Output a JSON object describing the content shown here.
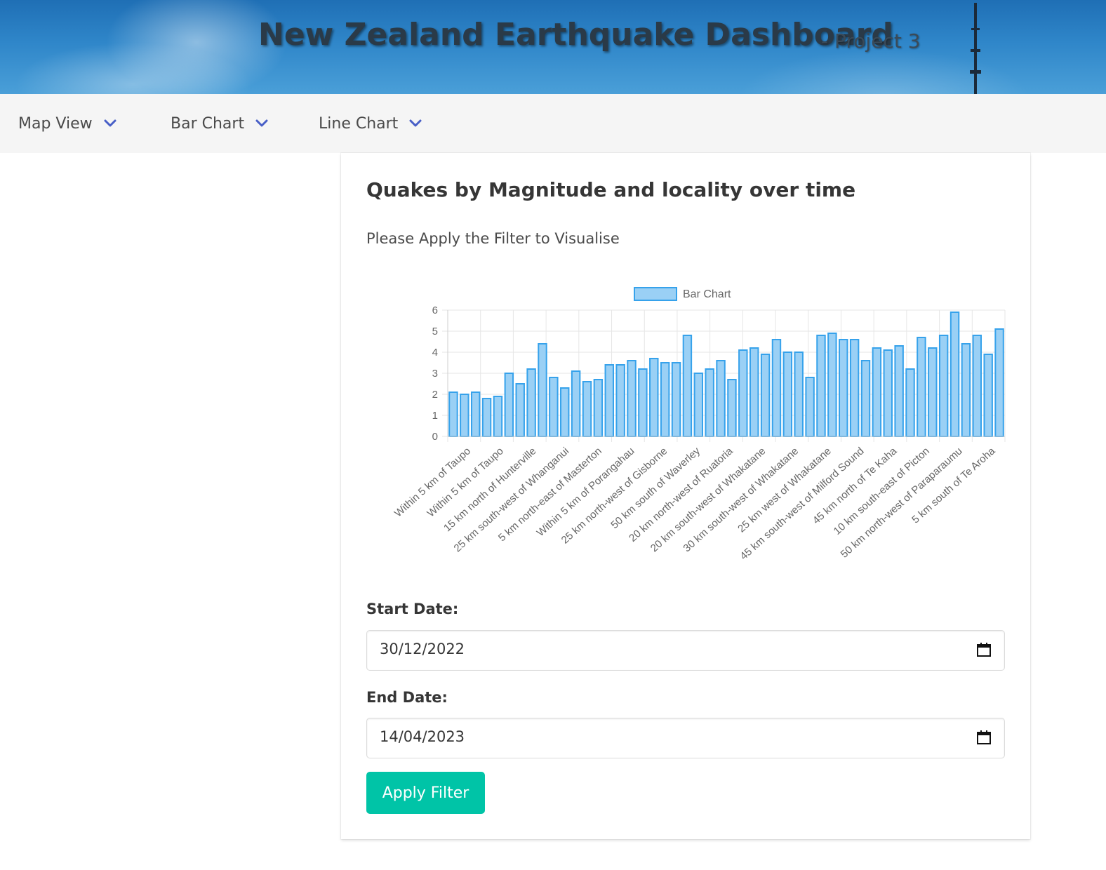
{
  "header": {
    "title": "New Zealand Earthquake Dashboard",
    "subtitle": "- Project 3"
  },
  "nav": {
    "items": [
      {
        "label": "Map View",
        "icon": "chevron-down-icon"
      },
      {
        "label": "Bar Chart",
        "icon": "chevron-down-icon"
      },
      {
        "label": "Line Chart",
        "icon": "chevron-down-icon"
      }
    ],
    "accent": "#485fc7"
  },
  "card": {
    "title": "Quakes by Magnitude and locality over time",
    "instruction": "Please Apply the Filter to Visualise"
  },
  "filter": {
    "start_label": "Start Date:",
    "start_value": "30/12/2022",
    "end_label": "End Date:",
    "end_value": "14/04/2023",
    "apply_label": "Apply Filter",
    "apply_color": "#00c4a7"
  },
  "chart_data": {
    "type": "bar",
    "legend": "Bar Chart",
    "legend_position": "top",
    "ylim": [
      0,
      6
    ],
    "yticks": [
      0,
      1,
      2,
      3,
      4,
      5,
      6
    ],
    "grid": true,
    "bar_fill": "#9ad0f5",
    "bar_border": "#36a2eb",
    "tick_labels": [
      "Within 5 km of Taupo",
      "Within 5 km of Taupo",
      "15 km north of Hunterville",
      "25 km south-west of Whanganui",
      "5 km north-east of Masterton",
      "Within 5 km of Porangahau",
      "25 km north-west of Gisborne",
      "50 km south of Waverley",
      "20 km north-west of Ruatoria",
      "20 km south-west of Whakatane",
      "30 km south-west of Whakatane",
      "25 km west of Whakatane",
      "45 km south-west of Milford Sound",
      "45 km north of Te Kaha",
      "10 km south-east of Picton",
      "50 km north-west of Paraparaumu",
      "5 km south of Te Aroha"
    ],
    "values": [
      2.1,
      2.0,
      2.1,
      1.8,
      1.9,
      3.0,
      2.5,
      3.2,
      4.4,
      2.8,
      2.3,
      3.1,
      2.6,
      2.7,
      3.4,
      3.4,
      3.6,
      3.2,
      3.7,
      3.5,
      3.5,
      4.8,
      3.0,
      3.2,
      3.6,
      2.7,
      4.1,
      4.2,
      3.9,
      4.6,
      4.0,
      4.0,
      2.8,
      4.8,
      4.9,
      4.6,
      4.6,
      3.6,
      4.2,
      4.1,
      4.3,
      3.2,
      4.7,
      4.2,
      4.8,
      5.9,
      4.4,
      4.8,
      3.9,
      5.1
    ]
  }
}
